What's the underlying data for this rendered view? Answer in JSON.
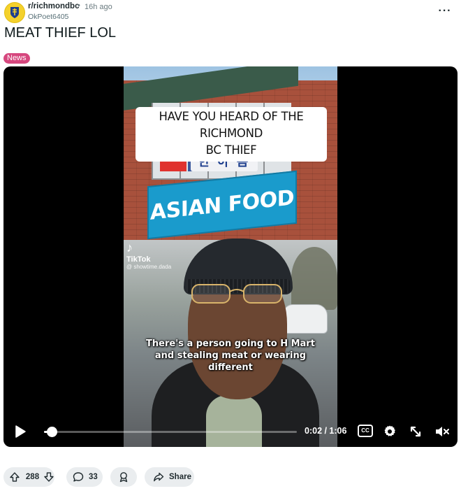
{
  "header": {
    "subreddit": "r/richmondbc",
    "separator": "•",
    "age": "16h ago",
    "author": "OkPoet6405",
    "more_icon": "ellipsis-icon"
  },
  "post": {
    "title": "MEAT THIEF LOL",
    "flair": "News",
    "flair_color": "#d6477e"
  },
  "video": {
    "caption_line1": "HAVE YOU HEARD OF THE RICHMOND",
    "caption_line2": "BC THIEF",
    "storefront_korean": "한 아 름",
    "storefront_logo": "H",
    "store_sign": "ASIAN FOOD",
    "watermark_app": "TikTok",
    "watermark_handle": "@ showtime.dada",
    "subtitle": "There's a person going to H Mart and stealing meat or wearing different",
    "time_display": "0:02 / 1:06",
    "progress": 0.03,
    "cc_label": "CC",
    "controls": [
      "play-icon",
      "closed-captions-icon",
      "settings-gear-icon",
      "fullscreen-icon",
      "mute-icon"
    ]
  },
  "actions": {
    "upvotes": "288",
    "comments": "33",
    "share_label": "Share"
  }
}
